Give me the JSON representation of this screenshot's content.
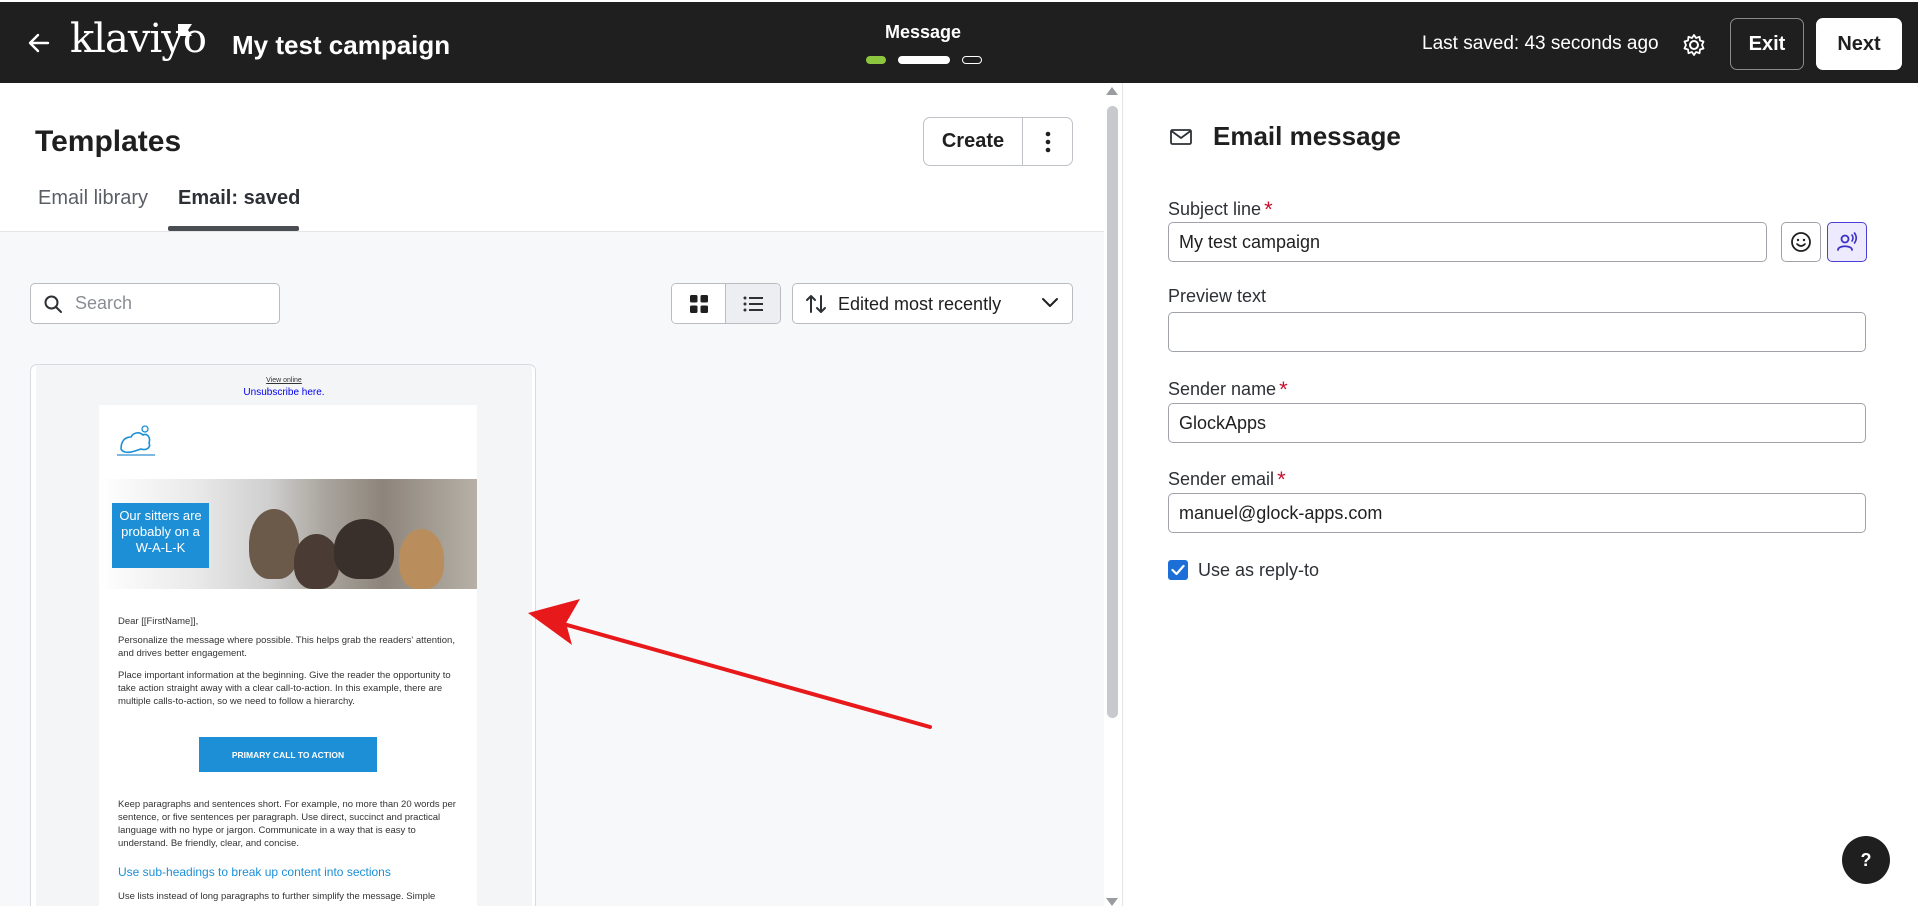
{
  "topbar": {
    "logo_text": "klaviyo",
    "campaign_title": "My test campaign",
    "step_label": "Message",
    "last_saved": "Last saved: 43 seconds ago",
    "exit_label": "Exit",
    "next_label": "Next"
  },
  "templates": {
    "title": "Templates",
    "create_label": "Create",
    "tabs": [
      {
        "label": "Email library",
        "active": false
      },
      {
        "label": "Email: saved",
        "active": true
      }
    ],
    "search_placeholder": "Search",
    "sort_label": "Edited most recently",
    "view_mode": "grid"
  },
  "template_preview": {
    "view_online": "View online",
    "unsubscribe": "Unsubscribe here.",
    "hero_text": "Our sitters are probably on a W-A-L-K",
    "greeting": "Dear [[FirstName]],",
    "para1": "Personalize the message where possible. This helps grab the readers' attention, and drives better engagement.",
    "para2": "Place important information at the beginning. Give the reader the opportunity to take action straight away with a clear call-to-action. In this example, there are multiple calls-to-action, so we need to follow a hierarchy.",
    "cta": "PRIMARY CALL TO ACTION",
    "para3": "Keep paragraphs and sentences short. For example, no more than 20 words per sentence, or five sentences per paragraph. Use direct, succinct and practical language with no hype or jargon. Communicate in a way that is easy to understand. Be friendly, clear, and concise.",
    "subheading": "Use sub-headings to break up content into sections",
    "para4": "Use lists instead of long paragraphs to further simplify the message. Simple"
  },
  "email_message": {
    "title": "Email message",
    "subject_label": "Subject line",
    "subject_value": "My test campaign",
    "preview_label": "Preview text",
    "preview_value": "",
    "sender_name_label": "Sender name",
    "sender_name_value": "GlockApps",
    "sender_email_label": "Sender email",
    "sender_email_value": "manuel@glock-apps.com",
    "reply_to_label": "Use as reply-to",
    "reply_to_checked": true
  },
  "help": {
    "label": "?"
  },
  "colors": {
    "topbar_bg": "#1f1f1f",
    "step_done": "#8cc63f",
    "accent_blue": "#1c8fd6",
    "required": "#c8102e",
    "annotation_arrow": "#e8191b"
  }
}
